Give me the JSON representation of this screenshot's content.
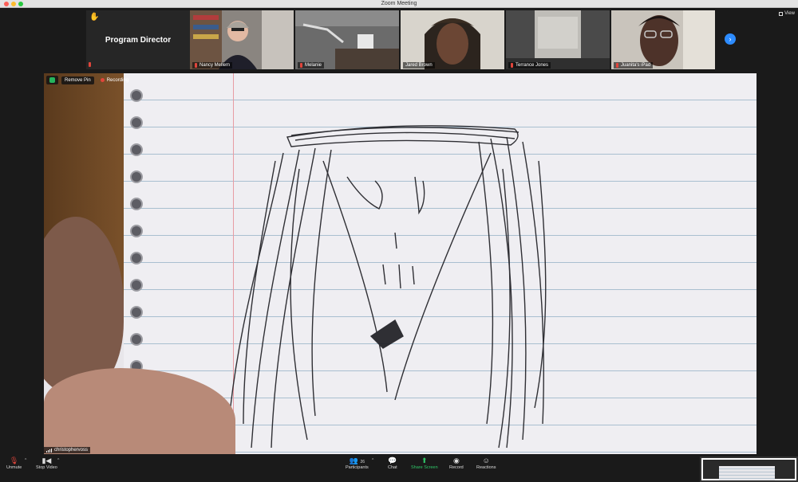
{
  "window": {
    "title": "Zoom Meeting"
  },
  "view_label": "View",
  "participants_strip": [
    {
      "name": "Program Director",
      "display": "text"
    },
    {
      "name": "Nancy Mellem",
      "display": "video"
    },
    {
      "name": "Melanie",
      "display": "video"
    },
    {
      "name": "Jared Brown",
      "display": "video"
    },
    {
      "name": "Terrance Jones",
      "display": "video"
    },
    {
      "name": "Juanita's iPad",
      "display": "video"
    }
  ],
  "main": {
    "remove_pin_label": "Remove Pin",
    "recording_label": "Recording",
    "speaker_name": "christophervoss"
  },
  "toolbar": {
    "unmute": "Unmute",
    "stop_video": "Stop Video",
    "participants": "Participants",
    "participants_count": "26",
    "chat": "Chat",
    "share_screen": "Share Screen",
    "record": "Record",
    "reactions": "Reactions"
  },
  "colors": {
    "share_green": "#2fc768",
    "muted_red": "#e0453b",
    "accent_blue": "#2d8cff"
  },
  "icons": [
    "raised-hand-icon",
    "mic-muted-icon",
    "shield-icon",
    "recording-dot-icon",
    "video-camera-icon",
    "participants-icon",
    "chat-icon",
    "share-screen-icon",
    "record-icon",
    "reactions-icon",
    "chevron-right-icon",
    "grid-view-icon"
  ]
}
